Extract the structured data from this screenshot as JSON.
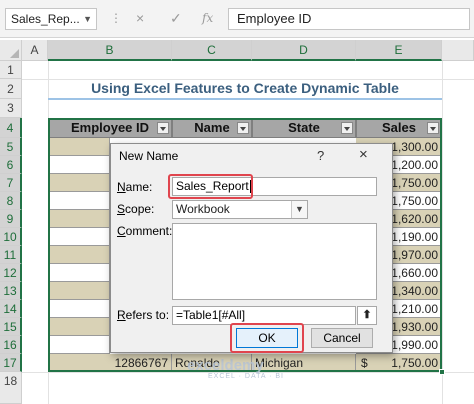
{
  "formula_bar": {
    "name_box": "Sales_Rep...",
    "cancel_icon": "×",
    "enter_icon": "✓",
    "fx_label": "fx",
    "content": "Employee ID"
  },
  "columns": [
    "A",
    "B",
    "C",
    "D",
    "E"
  ],
  "rows": [
    "1",
    "2",
    "3",
    "4",
    "5",
    "6",
    "7",
    "8",
    "9",
    "10",
    "11",
    "12",
    "13",
    "14",
    "15",
    "16",
    "17",
    "18"
  ],
  "sheet_title": "Using Excel Features to Create Dynamic Table",
  "table": {
    "headers": [
      "Employee ID",
      "Name",
      "State",
      "Sales"
    ],
    "sales": [
      "1,300.00",
      "1,200.00",
      "1,750.00",
      "1,750.00",
      "1,620.00",
      "1,190.00",
      "1,970.00",
      "1,660.00",
      "1,340.00",
      "1,210.00",
      "1,930.00",
      "1,990.00",
      "1,750.00"
    ],
    "last_row": {
      "id": "12866767",
      "name": "Ronaldo",
      "state": "Michigan",
      "currency": "$",
      "sales": "1,750.00"
    }
  },
  "dialog": {
    "title": "New Name",
    "help": "?",
    "close": "×",
    "name_label_u": "N",
    "name_label_rest": "ame:",
    "name_value": "Sales_Report",
    "scope_label_u": "S",
    "scope_label_rest": "cope:",
    "scope_value": "Workbook",
    "comment_label_u": "C",
    "comment_label_rest": "omment:",
    "refers_label_u": "R",
    "refers_label_rest": "efers to:",
    "refers_value": "=Table1[#All]",
    "ok_label": "OK",
    "cancel_label": "Cancel"
  },
  "watermark": {
    "brand": "exceldemy",
    "tagline": "EXCEL · DATA · BI"
  },
  "colors": {
    "accent": "#217346",
    "highlight": "#e0454e",
    "header_fill": "#a6a6a6",
    "band_fill": "#d9d2b6"
  }
}
